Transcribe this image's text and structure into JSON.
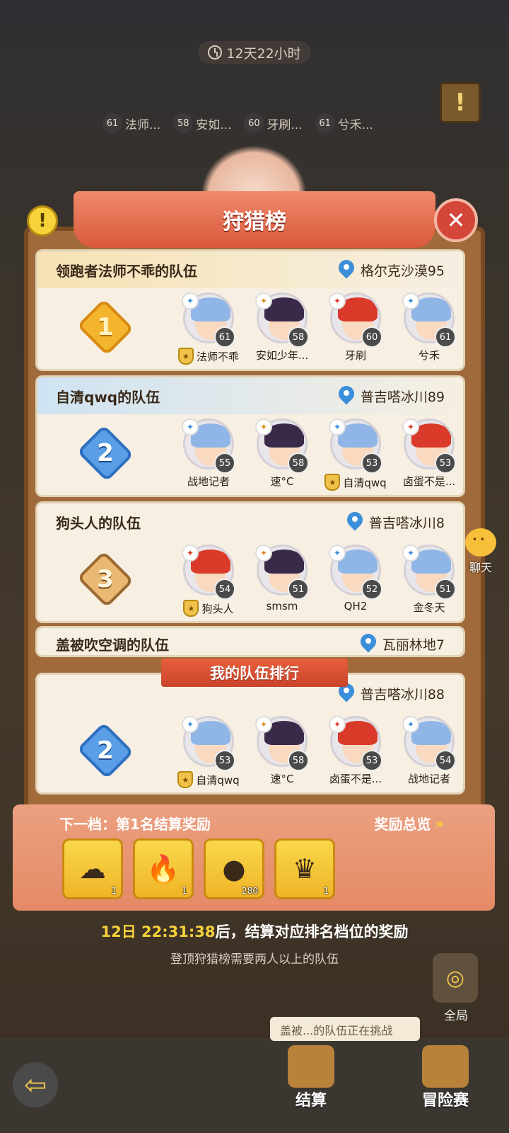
{
  "top": {
    "timer": "12天22小时",
    "members": [
      {
        "level": "61",
        "name": "法师..."
      },
      {
        "level": "58",
        "name": "安如..."
      },
      {
        "level": "60",
        "name": "牙刷..."
      },
      {
        "level": "61",
        "name": "兮禾..."
      }
    ]
  },
  "panel": {
    "title": "狩猎榜",
    "my_rank_label": "我的队伍排行"
  },
  "teams": [
    {
      "name": "领跑者法师不乖的队伍",
      "location": "格尔克沙漠95",
      "rank": "1",
      "members": [
        {
          "name": "法师不乖",
          "level": "61",
          "leader": true
        },
        {
          "name": "安如少年...",
          "level": "58",
          "leader": false
        },
        {
          "name": "牙刷",
          "level": "60",
          "leader": false
        },
        {
          "name": "兮禾",
          "level": "61",
          "leader": false
        }
      ]
    },
    {
      "name": "自清qwq的队伍",
      "location": "普吉嗒冰川89",
      "rank": "2",
      "members": [
        {
          "name": "战地记者",
          "level": "55",
          "leader": false
        },
        {
          "name": "速°C",
          "level": "58",
          "leader": false
        },
        {
          "name": "自清qwq",
          "level": "53",
          "leader": true
        },
        {
          "name": "卤蛋不是...",
          "level": "53",
          "leader": false
        }
      ]
    },
    {
      "name": "狗头人的队伍",
      "location": "普吉嗒冰川8",
      "rank": "3",
      "members": [
        {
          "name": "狗头人",
          "level": "54",
          "leader": true
        },
        {
          "name": "smsm",
          "level": "51",
          "leader": false
        },
        {
          "name": "QH2",
          "level": "52",
          "leader": false
        },
        {
          "name": "金冬天",
          "level": "51",
          "leader": false
        }
      ]
    },
    {
      "name": "盖被吹空调的队伍",
      "location": "瓦丽林地7"
    }
  ],
  "my_team": {
    "location": "普吉嗒冰川88",
    "rank": "2",
    "members": [
      {
        "name": "自清qwq",
        "level": "53",
        "leader": true
      },
      {
        "name": "速°C",
        "level": "58",
        "leader": false
      },
      {
        "name": "卤蛋不是...",
        "level": "53",
        "leader": false
      },
      {
        "name": "战地记者",
        "level": "54",
        "leader": false
      }
    ]
  },
  "rewards": {
    "next_tier": "下一档：第1名结算奖励",
    "overview": "奖励总览",
    "items": [
      {
        "icon": "storm-cloud-icon",
        "qty": "1"
      },
      {
        "icon": "flame-icon",
        "qty": "1"
      },
      {
        "icon": "amber-orb-icon",
        "qty": "280"
      },
      {
        "icon": "treasure-chest-icon",
        "qty": "1"
      }
    ]
  },
  "settlement": {
    "time": "12日 22:31:38",
    "text": "后，结算对应排名档位的奖励",
    "hint": "登顶狩猎榜需要两人以上的队伍"
  },
  "side": {
    "chat": "聊天",
    "global": "全局"
  },
  "bottom": {
    "notice": "盖被...的队伍正在挑战",
    "settle": "结算",
    "adventure": "冒险赛"
  }
}
